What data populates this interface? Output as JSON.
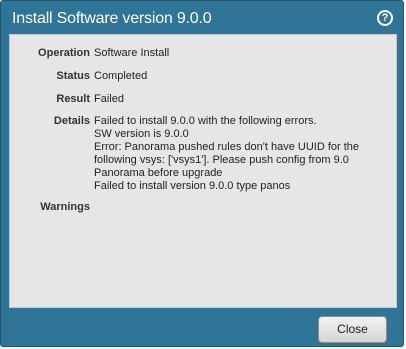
{
  "dialog": {
    "title": "Install Software version 9.0.0",
    "help_icon": "?"
  },
  "fields": {
    "operation": {
      "label": "Operation",
      "value": "Software Install"
    },
    "status": {
      "label": "Status",
      "value": "Completed"
    },
    "result": {
      "label": "Result",
      "value": "Failed"
    },
    "details": {
      "label": "Details",
      "lines": [
        "Failed to install 9.0.0 with the following errors.",
        "SW version is 9.0.0",
        "Error: Panorama pushed rules don't have UUID for the",
        "following vsys: ['vsys1']. Please push config from 9.0",
        "Panorama before upgrade",
        "Failed to install version 9.0.0 type panos"
      ]
    },
    "warnings": {
      "label": "Warnings",
      "value": ""
    }
  },
  "buttons": {
    "close": "Close"
  },
  "colors": {
    "header": "#2e7597",
    "content_bg": "#e6e6e6"
  }
}
